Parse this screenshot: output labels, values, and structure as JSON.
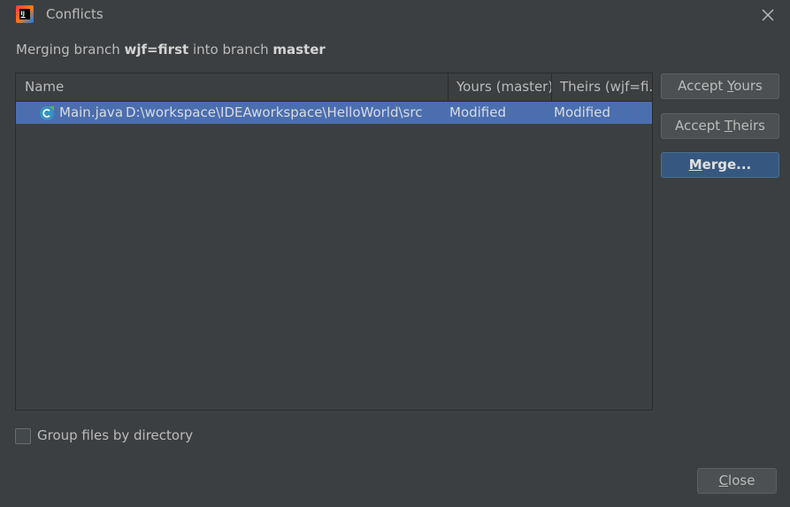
{
  "window": {
    "title": "Conflicts",
    "close_icon": "close-icon",
    "app_icon": "intellij-idea-icon"
  },
  "subtitle": {
    "prefix": "Merging branch ",
    "source_branch": "wjf=first",
    "middle": " into branch ",
    "target_branch": "master"
  },
  "table": {
    "columns": [
      "Name",
      "Yours (master)",
      "Theirs (wjf=fi..."
    ],
    "rows": [
      {
        "icon": "java-class-icon",
        "file": "Main.java",
        "path": "D:\\workspace\\IDEAworkspace\\HelloWorld\\src",
        "yours": "Modified",
        "theirs": "Modified"
      }
    ]
  },
  "buttons": {
    "accept_yours": {
      "before": "Accept ",
      "mnemonic": "Y",
      "after": "ours"
    },
    "accept_theirs": {
      "before": "Accept ",
      "mnemonic": "T",
      "after": "heirs"
    },
    "merge": {
      "mnemonic": "M",
      "after": "erge..."
    },
    "close": {
      "mnemonic": "C",
      "after": "lose"
    }
  },
  "group_files_label": "Group files by directory",
  "colors": {
    "background": "#3c3f41",
    "selection": "#4b6eaf",
    "primary_button": "#365880"
  }
}
